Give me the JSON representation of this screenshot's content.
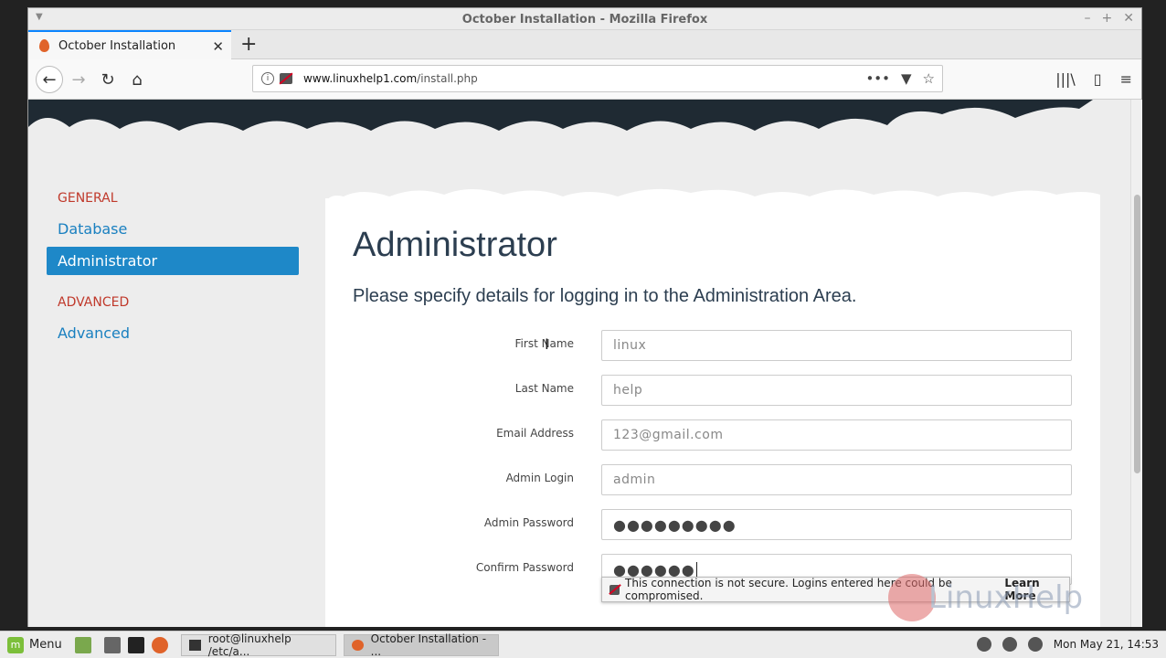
{
  "window": {
    "title": "October Installation - Mozilla Firefox",
    "min": "–",
    "max": "+",
    "close": "✕",
    "menu": "▼"
  },
  "tab": {
    "label": "October Installation",
    "close": "✕",
    "new": "+"
  },
  "nav": {
    "back": "←",
    "forward": "→",
    "reload": "↻",
    "home": "⌂",
    "url_domain": "www.linuxhelp1.com",
    "url_path": "/install.php",
    "page_actions": "•••",
    "pocket": "▼",
    "bookmark": "☆",
    "library": "|||\\",
    "sidebar": "▯",
    "menu": "≡"
  },
  "sidebar": {
    "general_heading": "GENERAL",
    "items_general": [
      "Database",
      "Administrator"
    ],
    "advanced_heading": "ADVANCED",
    "items_advanced": [
      "Advanced"
    ]
  },
  "panel": {
    "title": "Administrator",
    "lead": "Please specify details for logging in to the Administration Area.",
    "fields": [
      {
        "label": "First Name",
        "value": "linux"
      },
      {
        "label": "Last Name",
        "value": "help"
      },
      {
        "label": "Email Address",
        "value": "123@gmail.com"
      },
      {
        "label": "Admin Login",
        "value": "admin"
      },
      {
        "label": "Admin Password",
        "value": "●●●●●●●●●"
      },
      {
        "label": "Confirm Password",
        "value": "●●●●●●"
      }
    ],
    "warning": "This connection is not secure. Logins entered here could be compromised.",
    "warning_link": "Learn More"
  },
  "watermark": {
    "text": "LinuxHelp"
  },
  "taskbar": {
    "menu": "Menu",
    "tasks": [
      "root@linuxhelp /etc/a...",
      "October Installation - ..."
    ],
    "clock": "Mon May 21, 14:53"
  },
  "colors": {
    "accent": "#1e88c8",
    "heading_red": "#c0392b",
    "link_blue": "#1a80c0",
    "sky": "#1f2a33"
  }
}
